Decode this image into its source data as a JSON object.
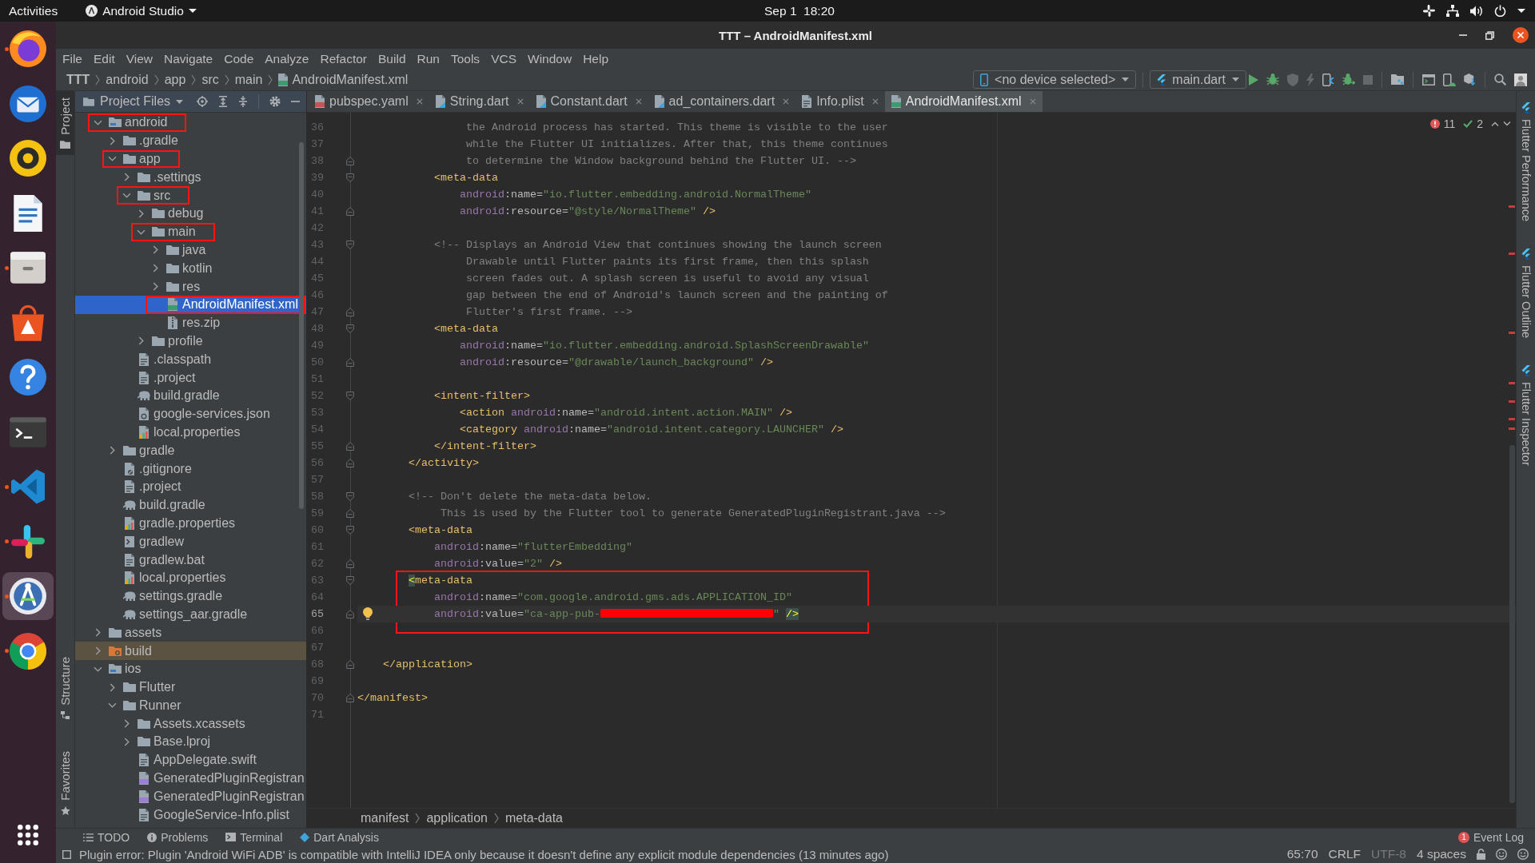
{
  "desktop_bar": {
    "activities": "Activities",
    "app_menu": "Android Studio",
    "clock": "Sep 1  18:20"
  },
  "dock": [
    {
      "kind": "browser",
      "running": true,
      "selected": false
    },
    {
      "kind": "mail",
      "running": false,
      "selected": false
    },
    {
      "kind": "music",
      "running": false,
      "selected": false
    },
    {
      "kind": "writer",
      "running": false,
      "selected": false
    },
    {
      "kind": "files",
      "running": true,
      "selected": false
    },
    {
      "kind": "store",
      "running": false,
      "selected": false
    },
    {
      "kind": "help",
      "running": false,
      "selected": false
    },
    {
      "kind": "terminal",
      "running": false,
      "selected": false
    },
    {
      "kind": "code",
      "running": true,
      "selected": false
    },
    {
      "kind": "chat",
      "running": true,
      "selected": false
    },
    {
      "kind": "ide",
      "running": true,
      "selected": true
    },
    {
      "kind": "web",
      "running": true,
      "selected": false
    }
  ],
  "window": {
    "title": "TTT – AndroidManifest.xml"
  },
  "menu": [
    "File",
    "Edit",
    "View",
    "Navigate",
    "Code",
    "Analyze",
    "Refactor",
    "Build",
    "Run",
    "Tools",
    "VCS",
    "Window",
    "Help"
  ],
  "navigation": {
    "path": [
      {
        "label": "TTT",
        "kind": "project"
      },
      {
        "label": "android",
        "kind": "folder"
      },
      {
        "label": "app",
        "kind": "folder"
      },
      {
        "label": "src",
        "kind": "folder"
      },
      {
        "label": "main",
        "kind": "folder"
      },
      {
        "label": "AndroidManifest.xml",
        "kind": "manifest"
      }
    ],
    "device_selector": "<no device selected>",
    "run_config": "main.dart",
    "toolbar_groups": [
      [
        {
          "kind": "run",
          "disabled": false
        },
        {
          "kind": "debug",
          "disabled": false
        },
        {
          "kind": "profile",
          "disabled": true
        },
        {
          "kind": "reload",
          "disabled": true
        },
        {
          "kind": "device",
          "disabled": false
        },
        {
          "kind": "attach",
          "disabled": false
        },
        {
          "kind": "stop",
          "disabled": true
        }
      ],
      [
        {
          "kind": "structure",
          "disabled": false
        }
      ],
      [
        {
          "kind": "window",
          "disabled": false
        },
        {
          "kind": "avd",
          "disabled": false
        },
        {
          "kind": "sdk",
          "disabled": false
        }
      ],
      [
        {
          "kind": "search",
          "disabled": false
        },
        {
          "kind": "account",
          "disabled": false
        }
      ]
    ]
  },
  "left_stripe": {
    "top": [
      {
        "label": "Project",
        "kind": "project",
        "selected": true
      }
    ],
    "bottom": [
      {
        "label": "Structure",
        "kind": "structure",
        "selected": false
      },
      {
        "label": "Favorites",
        "kind": "favorites",
        "selected": false
      }
    ]
  },
  "project_panel": {
    "title": "Project Files",
    "tree": [
      {
        "label": "android",
        "kind": "module",
        "expanded": true,
        "selected": false,
        "outlined": true,
        "children": [
          {
            "label": ".gradle",
            "kind": "folder",
            "expanded": false,
            "selected": false,
            "outlined": false
          },
          {
            "label": "app",
            "kind": "folder",
            "expanded": true,
            "selected": false,
            "outlined": true,
            "children": [
              {
                "label": ".settings",
                "kind": "folder",
                "expanded": false,
                "selected": false,
                "outlined": false
              },
              {
                "label": "src",
                "kind": "folder",
                "expanded": true,
                "selected": false,
                "outlined": true,
                "children": [
                  {
                    "label": "debug",
                    "kind": "folder",
                    "expanded": false,
                    "selected": false,
                    "outlined": false
                  },
                  {
                    "label": "main",
                    "kind": "folder",
                    "expanded": true,
                    "selected": false,
                    "outlined": true,
                    "children": [
                      {
                        "label": "java",
                        "kind": "folder",
                        "expanded": false,
                        "selected": false,
                        "outlined": false
                      },
                      {
                        "label": "kotlin",
                        "kind": "folder",
                        "expanded": false,
                        "selected": false,
                        "outlined": false
                      },
                      {
                        "label": "res",
                        "kind": "folder",
                        "expanded": false,
                        "selected": false,
                        "outlined": false
                      },
                      {
                        "label": "AndroidManifest.xml",
                        "kind": "manifest",
                        "selected": true,
                        "outlined": true
                      },
                      {
                        "label": "res.zip",
                        "kind": "zip",
                        "selected": false,
                        "outlined": false
                      }
                    ]
                  },
                  {
                    "label": "profile",
                    "kind": "folder",
                    "expanded": false,
                    "selected": false,
                    "outlined": false
                  }
                ]
              },
              {
                "label": ".classpath",
                "kind": "file",
                "selected": false,
                "outlined": false
              },
              {
                "label": ".project",
                "kind": "file",
                "selected": false,
                "outlined": false
              },
              {
                "label": "build.gradle",
                "kind": "gradle",
                "selected": false,
                "outlined": false
              },
              {
                "label": "google-services.json",
                "kind": "json",
                "selected": false,
                "outlined": false
              },
              {
                "label": "local.properties",
                "kind": "properties",
                "selected": false,
                "outlined": false
              }
            ]
          },
          {
            "label": "gradle",
            "kind": "folder",
            "expanded": false,
            "selected": false,
            "outlined": false
          },
          {
            "label": ".gitignore",
            "kind": "gitignore",
            "selected": false,
            "outlined": false
          },
          {
            "label": ".project",
            "kind": "file",
            "selected": false,
            "outlined": false
          },
          {
            "label": "build.gradle",
            "kind": "gradle",
            "selected": false,
            "outlined": false
          },
          {
            "label": "gradle.properties",
            "kind": "properties",
            "selected": false,
            "outlined": false
          },
          {
            "label": "gradlew",
            "kind": "script",
            "selected": false,
            "outlined": false
          },
          {
            "label": "gradlew.bat",
            "kind": "file",
            "selected": false,
            "outlined": false
          },
          {
            "label": "local.properties",
            "kind": "properties",
            "selected": false,
            "outlined": false
          },
          {
            "label": "settings.gradle",
            "kind": "gradle",
            "selected": false,
            "outlined": false
          },
          {
            "label": "settings_aar.gradle",
            "kind": "gradle",
            "selected": false,
            "outlined": false
          }
        ]
      },
      {
        "label": "assets",
        "kind": "folder",
        "expanded": false,
        "selected": false,
        "outlined": false
      },
      {
        "label": "build",
        "kind": "excluded",
        "expanded": false,
        "selected": false,
        "outlined": false
      },
      {
        "label": "ios",
        "kind": "module",
        "expanded": true,
        "selected": false,
        "outlined": false,
        "children": [
          {
            "label": "Flutter",
            "kind": "folder",
            "expanded": false,
            "selected": false,
            "outlined": false
          },
          {
            "label": "Runner",
            "kind": "folder",
            "expanded": true,
            "selected": false,
            "outlined": false,
            "children": [
              {
                "label": "Assets.xcassets",
                "kind": "folder",
                "expanded": false,
                "selected": false,
                "outlined": false
              },
              {
                "label": "Base.lproj",
                "kind": "folder",
                "expanded": false,
                "selected": false,
                "outlined": false
              },
              {
                "label": "AppDelegate.swift",
                "kind": "file",
                "selected": false,
                "outlined": false
              },
              {
                "label": "GeneratedPluginRegistran",
                "kind": "cpp",
                "selected": false,
                "outlined": false
              },
              {
                "label": "GeneratedPluginRegistran",
                "kind": "cpp",
                "selected": false,
                "outlined": false
              },
              {
                "label": "GoogleService-Info.plist",
                "kind": "file",
                "selected": false,
                "outlined": false
              }
            ]
          }
        ]
      }
    ]
  },
  "editor": {
    "tabs": [
      {
        "label": "pubspec.yaml",
        "kind": "yaml",
        "selected": false
      },
      {
        "label": "String.dart",
        "kind": "dart",
        "selected": false
      },
      {
        "label": "Constant.dart",
        "kind": "dart",
        "selected": false
      },
      {
        "label": "ad_containers.dart",
        "kind": "dart",
        "selected": false
      },
      {
        "label": "Info.plist",
        "kind": "file",
        "selected": false
      },
      {
        "label": "AndroidManifest.xml",
        "kind": "manifest",
        "selected": true
      }
    ],
    "errors": "11",
    "checks": "2",
    "lines": [
      {
        "number": "36",
        "current": false,
        "outlined": false,
        "tokens": [
          {
            "kind": "comment",
            "text": "                 the Android process has started. This theme is visible to the user"
          }
        ]
      },
      {
        "number": "37",
        "current": false,
        "outlined": false,
        "tokens": [
          {
            "kind": "comment",
            "text": "                 while the Flutter UI initializes. After that, this theme continues"
          }
        ]
      },
      {
        "number": "38",
        "current": false,
        "outlined": false,
        "fold_open": false,
        "tokens": [
          {
            "kind": "comment",
            "text": "                 to determine the Window background behind the Flutter UI. -->"
          }
        ]
      },
      {
        "number": "39",
        "current": false,
        "outlined": false,
        "fold_open": true,
        "tokens": [
          {
            "kind": "tag",
            "text": "            <meta-data"
          }
        ]
      },
      {
        "number": "40",
        "current": false,
        "outlined": false,
        "tokens": [
          {
            "kind": "ns",
            "text": "                android"
          },
          {
            "kind": "attr",
            "text": ":name="
          },
          {
            "kind": "string",
            "text": "\"io.flutter.embedding.android.NormalTheme\""
          }
        ]
      },
      {
        "number": "41",
        "current": false,
        "outlined": false,
        "fold_open": false,
        "tokens": [
          {
            "kind": "ns",
            "text": "                android"
          },
          {
            "kind": "attr",
            "text": ":resource="
          },
          {
            "kind": "string",
            "text": "\"@style/NormalTheme\""
          },
          {
            "kind": "tag",
            "text": " />"
          }
        ]
      },
      {
        "number": "42",
        "current": false,
        "outlined": false
      },
      {
        "number": "43",
        "current": false,
        "outlined": false,
        "fold_open": true,
        "tokens": [
          {
            "kind": "comment",
            "text": "            <!-- Displays an Android View that continues showing the launch screen"
          }
        ]
      },
      {
        "number": "44",
        "current": false,
        "outlined": false,
        "tokens": [
          {
            "kind": "comment",
            "text": "                 Drawable until Flutter paints its first frame, then this splash"
          }
        ]
      },
      {
        "number": "45",
        "current": false,
        "outlined": false,
        "tokens": [
          {
            "kind": "comment",
            "text": "                 screen fades out. A splash screen is useful to avoid any visual"
          }
        ]
      },
      {
        "number": "46",
        "current": false,
        "outlined": false,
        "tokens": [
          {
            "kind": "comment",
            "text": "                 gap between the end of Android's launch screen and the painting of"
          }
        ]
      },
      {
        "number": "47",
        "current": false,
        "outlined": false,
        "fold_open": false,
        "tokens": [
          {
            "kind": "comment",
            "text": "                 Flutter's first frame. -->"
          }
        ]
      },
      {
        "number": "48",
        "current": false,
        "outlined": false,
        "fold_open": true,
        "tokens": [
          {
            "kind": "tag",
            "text": "            <meta-data"
          }
        ]
      },
      {
        "number": "49",
        "current": false,
        "outlined": false,
        "tokens": [
          {
            "kind": "ns",
            "text": "                android"
          },
          {
            "kind": "attr",
            "text": ":name="
          },
          {
            "kind": "string",
            "text": "\"io.flutter.embedding.android.SplashScreenDrawable\""
          }
        ]
      },
      {
        "number": "50",
        "current": false,
        "outlined": false,
        "fold_open": false,
        "tokens": [
          {
            "kind": "ns",
            "text": "                android"
          },
          {
            "kind": "attr",
            "text": ":resource="
          },
          {
            "kind": "string",
            "text": "\"@drawable/launch_background\""
          },
          {
            "kind": "tag",
            "text": " />"
          }
        ]
      },
      {
        "number": "51",
        "current": false,
        "outlined": false
      },
      {
        "number": "52",
        "current": false,
        "outlined": false,
        "fold_open": true,
        "tokens": [
          {
            "kind": "tag",
            "text": "            <intent-filter>"
          }
        ]
      },
      {
        "number": "53",
        "current": false,
        "outlined": false,
        "tokens": [
          {
            "kind": "tag",
            "text": "                <action"
          },
          {
            "kind": "ns",
            "text": " android"
          },
          {
            "kind": "attr",
            "text": ":name="
          },
          {
            "kind": "string",
            "text": "\"android.intent.action.MAIN\""
          },
          {
            "kind": "tag",
            "text": " />"
          }
        ]
      },
      {
        "number": "54",
        "current": false,
        "outlined": false,
        "tokens": [
          {
            "kind": "tag",
            "text": "                <category"
          },
          {
            "kind": "ns",
            "text": " android"
          },
          {
            "kind": "attr",
            "text": ":name="
          },
          {
            "kind": "string",
            "text": "\"android.intent.category.LAUNCHER\""
          },
          {
            "kind": "tag",
            "text": " />"
          }
        ]
      },
      {
        "number": "55",
        "current": false,
        "outlined": false,
        "fold_open": false,
        "tokens": [
          {
            "kind": "tag",
            "text": "            </intent-filter>"
          }
        ]
      },
      {
        "number": "56",
        "current": false,
        "outlined": false,
        "fold_open": false,
        "tokens": [
          {
            "kind": "tag",
            "text": "        </activity>"
          }
        ]
      },
      {
        "number": "57",
        "current": false,
        "outlined": false
      },
      {
        "number": "58",
        "current": false,
        "outlined": false,
        "fold_open": true,
        "tokens": [
          {
            "kind": "comment",
            "text": "        <!-- Don't delete the meta-data below."
          }
        ]
      },
      {
        "number": "59",
        "current": false,
        "outlined": false,
        "fold_open": false,
        "tokens": [
          {
            "kind": "comment",
            "text": "             This is used by the Flutter tool to generate GeneratedPluginRegistrant.java -->"
          }
        ]
      },
      {
        "number": "60",
        "current": false,
        "outlined": false,
        "fold_open": true,
        "tokens": [
          {
            "kind": "tag",
            "text": "        <meta-data"
          }
        ]
      },
      {
        "number": "61",
        "current": false,
        "outlined": false,
        "tokens": [
          {
            "kind": "ns",
            "text": "            android"
          },
          {
            "kind": "attr",
            "text": ":name="
          },
          {
            "kind": "string",
            "text": "\"flutterEmbedding\""
          }
        ]
      },
      {
        "number": "62",
        "current": false,
        "outlined": false,
        "fold_open": false,
        "tokens": [
          {
            "kind": "ns",
            "text": "            android"
          },
          {
            "kind": "attr",
            "text": ":value="
          },
          {
            "kind": "string",
            "text": "\"2\""
          },
          {
            "kind": "tag",
            "text": " />"
          }
        ]
      },
      {
        "number": "63",
        "current": false,
        "outlined": true,
        "fold_open": true,
        "tokens": [
          {
            "kind": "match",
            "text": "        <"
          },
          {
            "kind": "tag",
            "text": "meta-data"
          }
        ]
      },
      {
        "number": "64",
        "current": false,
        "outlined": true,
        "tokens": [
          {
            "kind": "ns",
            "text": "            android"
          },
          {
            "kind": "attr",
            "text": ":name="
          },
          {
            "kind": "string",
            "text": "\"com.google.android.gms.ads.APPLICATION_ID\""
          }
        ]
      },
      {
        "number": "65",
        "current": true,
        "outlined": true,
        "fold_open": false,
        "tokens": [
          {
            "kind": "ns",
            "text": "            android"
          },
          {
            "kind": "attr",
            "text": ":value="
          },
          {
            "kind": "string",
            "text": "\"ca-app-pub-"
          },
          {
            "kind": "redacted"
          },
          {
            "kind": "string",
            "text": "\" "
          },
          {
            "kind": "match",
            "text": "/>"
          }
        ]
      },
      {
        "number": "66",
        "current": false,
        "outlined": true
      },
      {
        "number": "67",
        "current": false,
        "outlined": false
      },
      {
        "number": "68",
        "current": false,
        "outlined": false,
        "fold_open": false,
        "tokens": [
          {
            "kind": "tag",
            "text": "    </application>"
          }
        ]
      },
      {
        "number": "69",
        "current": false,
        "outlined": false
      },
      {
        "number": "70",
        "current": false,
        "outlined": false,
        "fold_open": false,
        "tokens": [
          {
            "kind": "tag",
            "text": "</manifest>"
          }
        ]
      },
      {
        "number": "71",
        "current": false,
        "outlined": false
      }
    ],
    "breadcrumb": [
      "manifest",
      "application",
      "meta-data"
    ]
  },
  "right_stripe": [
    {
      "label": "Flutter Performance",
      "selected": false
    },
    {
      "label": "Flutter Outline",
      "selected": false
    },
    {
      "label": "Flutter Inspector",
      "selected": false
    }
  ],
  "tool_windows": [
    {
      "label": "TODO",
      "kind": "todo",
      "selected": false
    },
    {
      "label": "Problems",
      "kind": "problems",
      "selected": false
    },
    {
      "label": "Terminal",
      "kind": "terminal",
      "selected": false
    },
    {
      "label": "Dart Analysis",
      "kind": "dart",
      "selected": false
    }
  ],
  "event_log": {
    "label": "Event Log",
    "badge": "1"
  },
  "status_bar": {
    "message": "Plugin error: Plugin 'Android WiFi ADB' is compatible with IntelliJ IDEA only because it doesn't define any explicit module dependencies (13 minutes ago)",
    "widgets": [
      {
        "text": "65:70",
        "disabled": false
      },
      {
        "text": "CRLF",
        "disabled": false
      },
      {
        "text": "UTF-8",
        "disabled": true
      },
      {
        "text": "4 spaces",
        "disabled": false
      }
    ]
  }
}
